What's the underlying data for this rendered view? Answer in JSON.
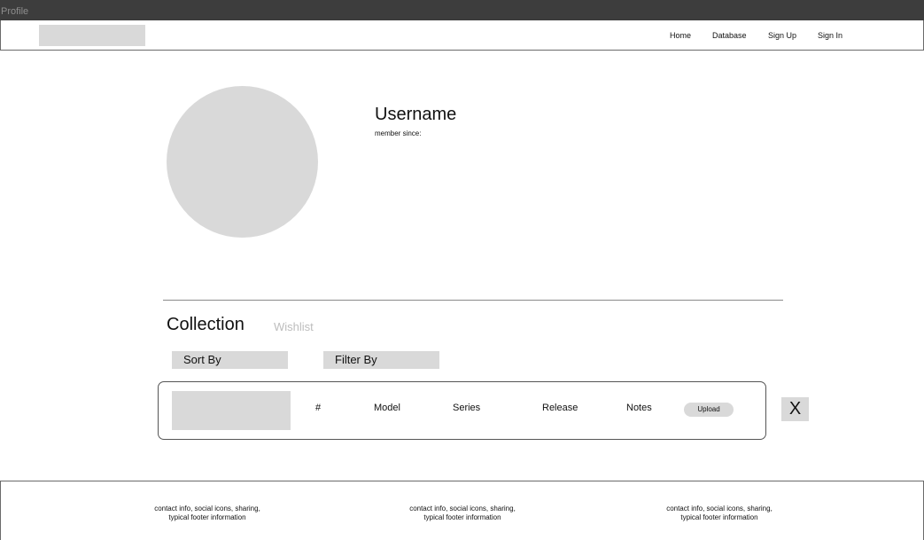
{
  "window": {
    "title": "Profile"
  },
  "nav": {
    "links": [
      "Home",
      "Database",
      "Sign Up",
      "Sign In"
    ]
  },
  "profile": {
    "username": "Username",
    "member_since": "member since:"
  },
  "tabs": {
    "collection": "Collection",
    "wishlist": "Wishlist"
  },
  "controls": {
    "sort": "Sort By",
    "filter": "Filter By"
  },
  "item": {
    "columns": [
      "#",
      "Model",
      "Series",
      "Release",
      "Notes"
    ],
    "upload": "Upload",
    "close": "X"
  },
  "footer": {
    "columns": [
      {
        "line1": "contact info, social icons, sharing,",
        "line2": "typical footer information"
      },
      {
        "line1": "contact info, social icons, sharing,",
        "line2": "typical footer information"
      },
      {
        "line1": "contact info, social icons, sharing,",
        "line2": "typical footer information"
      }
    ]
  },
  "colors": {
    "titlebar": "#3d3d3d",
    "placeholder": "#d9d9d9",
    "muted_text": "#bdbdbd",
    "border": "#6a6a6a"
  }
}
